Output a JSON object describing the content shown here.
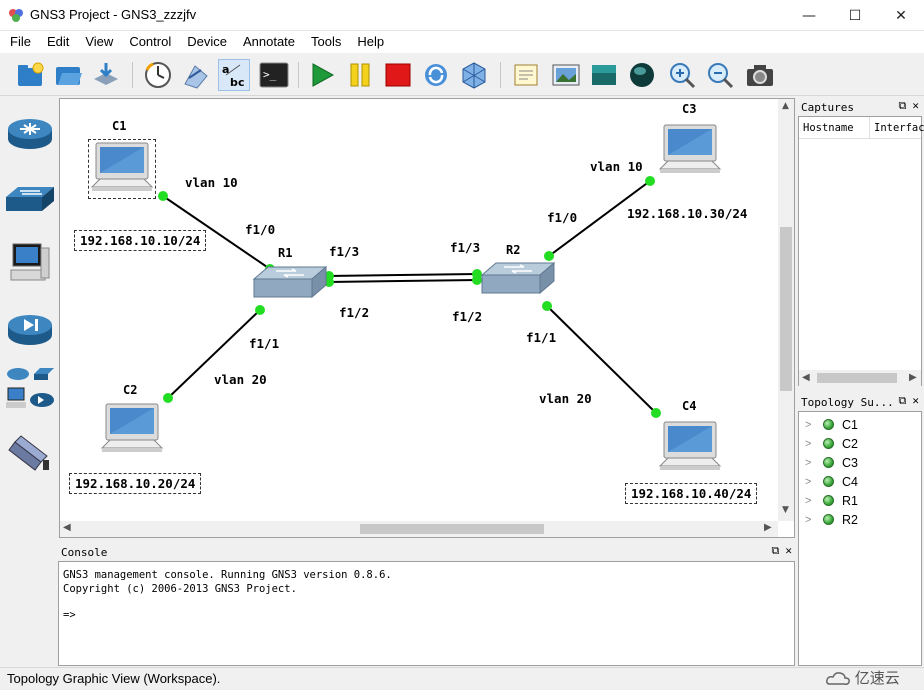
{
  "window": {
    "title": "GNS3 Project - GNS3_zzzjfv",
    "min_glyph": "—",
    "max_glyph": "☐",
    "close_glyph": "✕"
  },
  "menu": [
    "File",
    "Edit",
    "View",
    "Control",
    "Device",
    "Annotate",
    "Tools",
    "Help"
  ],
  "toolbar": {
    "icons": [
      "new-project-icon",
      "open-project-icon",
      "save-project-icon",
      "snapshot-icon",
      "emulated-devices-icon",
      "show-interface-labels-icon",
      "console-icon",
      "start-all-icon",
      "suspend-all-icon",
      "stop-all-icon",
      "reload-all-icon",
      "virtualbox-icon",
      "add-note-icon",
      "insert-picture-icon",
      "draw-rectangle-icon",
      "draw-ellipse-icon",
      "zoom-in-icon",
      "zoom-out-icon",
      "screenshot-icon"
    ]
  },
  "device_panel": [
    "router-icon",
    "switch-icon",
    "host-icon",
    "atm-icon",
    "all-devices-icon",
    "cloud-icon"
  ],
  "topology": {
    "nodes": {
      "c1": {
        "name": "C1",
        "ip": "192.168.10.10/24"
      },
      "c2": {
        "name": "C2",
        "ip": "192.168.10.20/24"
      },
      "c3": {
        "name": "C3",
        "ip": "192.168.10.30/24"
      },
      "c4": {
        "name": "C4",
        "ip": "192.168.10.40/24"
      },
      "r1": {
        "name": "R1"
      },
      "r2": {
        "name": "R2"
      }
    },
    "labels": {
      "vlan_c1": "vlan 10",
      "vlan_c2": "vlan 20",
      "vlan_c3": "vlan 10",
      "vlan_c4": "vlan 20",
      "r1_f10": "f1/0",
      "r1_f11": "f1/1",
      "r1_f12": "f1/2",
      "r1_f13": "f1/3",
      "r2_f10": "f1/0",
      "r2_f11": "f1/1",
      "r2_f12": "f1/2",
      "r2_f13": "f1/3"
    }
  },
  "captures": {
    "title": "Captures",
    "col_hostname": "Hostname",
    "col_interface": "Interfac"
  },
  "topology_summary": {
    "title": "Topology Su...",
    "items": [
      "C1",
      "C2",
      "C3",
      "C4",
      "R1",
      "R2"
    ]
  },
  "console": {
    "title": "Console",
    "line1": "GNS3 management console. Running GNS3 version 0.8.6.",
    "line2": "Copyright (c) 2006-2013 GNS3 Project.",
    "prompt": "=>"
  },
  "status": "Topology Graphic View (Workspace).",
  "watermark": "亿速云",
  "colors": {
    "link_dot": "#22dd22",
    "panel_bg": "#f0f0f0"
  }
}
